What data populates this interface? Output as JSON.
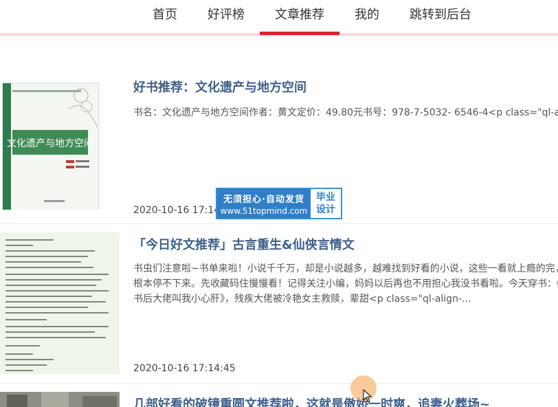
{
  "nav": {
    "items": [
      {
        "label": "首页"
      },
      {
        "label": "好评榜"
      },
      {
        "label": "文章推荐"
      },
      {
        "label": "我的"
      },
      {
        "label": "跳转到后台"
      }
    ],
    "active_index": 2
  },
  "articles": [
    {
      "title": "好书推荐：文化遗产与地方空间",
      "summary": "书名：文化遗产与地方空间作者：黄文定价：49.80元书号：978-7-5032- 6546-4<p class=\"ql-align",
      "date": "2020-10-16 17:14:45",
      "cover_title": "文化遗产与地方空间"
    },
    {
      "title": "「今日好文推荐」古言重生&仙侠言情文",
      "summary": "书虫们注意啦~书单来啦！小说千千万，却是小说越多，越难找到好看的小说，这些一看就上瘾的完，根本停不下来。先收藏码住慢慢看！记得关注小编，妈妈以后再也不用担心我没书看啦。今天穿书：《穿书后大佬叫我小心肝》，残疾大佬被冷艳女主救赎，辈甜<p class=\"ql-align-...",
      "date": "2020-10-16 17:14:45"
    },
    {
      "title": "几部好看的破镜重圆文推荐啦，这就是傲娇一时爽，追妻火葬场~"
    }
  ],
  "watermark": {
    "line1": "无须担心·自动发货",
    "line2": "www.51topmind.com",
    "right1": "毕业",
    "right2": "设计"
  },
  "colors": {
    "accent": "#d9272e",
    "title": "#3e5f8a",
    "watermark": "#2f7fc8"
  }
}
